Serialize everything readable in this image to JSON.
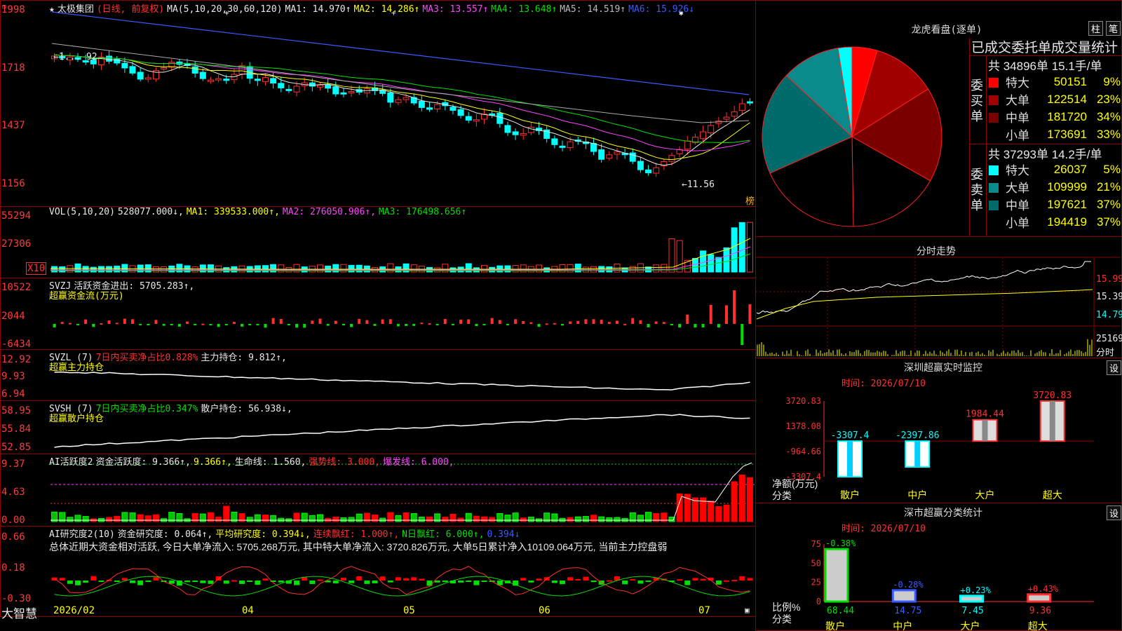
{
  "main": {
    "stock_name": "太极集团",
    "period": "(日线, 前复权)",
    "ma_label": "MA(5,10,20,30,60,120)",
    "ma": [
      {
        "name": "MA1:",
        "val": "14.970↑",
        "color": "#e8e8e8"
      },
      {
        "name": "MA2:",
        "val": "14.286↑",
        "color": "#ffff00"
      },
      {
        "name": "MA3:",
        "val": "13.557↑",
        "color": "#ff44ff"
      },
      {
        "name": "MA4:",
        "val": "13.648↑",
        "color": "#00e000"
      },
      {
        "name": "MA5:",
        "val": "14.519↑",
        "color": "#bbbbbb"
      },
      {
        "name": "MA6:",
        "val": "15.926↓",
        "color": "#3a5bff"
      }
    ],
    "y_ticks": [
      "1998",
      "1718",
      "1437",
      "1156"
    ],
    "high_mark": "←1... 92",
    "low_mark": "←11.56",
    "side_tag": "榜"
  },
  "vol": {
    "label": "VOL(5,10,20)",
    "v": "528077.000↓,",
    "ma1": "MA1: 339533.000↑,",
    "ma2": "MA2: 276050.906↑,",
    "ma3": "MA3: 176498.656↑",
    "y_ticks": [
      "55294",
      "27306"
    ],
    "x10": "X10"
  },
  "svzj": {
    "l1a": "SVZJ",
    "l1b": "活跃资金进出: 5705.283↑,",
    "l2": "超赢资金流(万元)",
    "y_ticks": [
      "10522",
      "2044",
      "-6434"
    ]
  },
  "svzl": {
    "l1a": "SVZL (7)",
    "l1b": "7日内买卖净占比0.828%",
    "l1c": "主力持仓: 9.812↑,",
    "l2": "超赢主力持仓",
    "y_ticks": [
      "12.92",
      "9.93",
      "6.94"
    ]
  },
  "svsh": {
    "l1a": "SVSH (7)",
    "l1b": "7日内买卖净占比0.347%",
    "l1c": "散户持仓: 56.938↓,",
    "l2": "超赢散户持仓",
    "y_ticks": [
      "58.95",
      "55.84",
      "52.85"
    ]
  },
  "ai1": {
    "a": "AI活跃度2",
    "b": "资金活跃度: 9.366↑,",
    "c": "9.366↑,",
    "d": "生命线: 1.560,",
    "e": "强势线: 3.000,",
    "f": "爆发线: 6.000,",
    "y_ticks": [
      "9.37",
      "4.63",
      "0.00"
    ]
  },
  "ai2": {
    "a": "AI研究度2(10)",
    "b": "资金研究度: 0.064↑,",
    "c": "平均研究度: 0.394↓,",
    "d": "连续飘红: 1.000↑,",
    "e": "N日飘红: 6.000↑,",
    "f": "0.394↓",
    "summary": "总体近期大资金相对活跃, 今日大单净流入: 5705.268万元, 其中特大单净流入: 3720.826万元, 大单5日累计净入10109.064万元, 当前主力控盘弱",
    "y_ticks": [
      "0.66",
      "0.18",
      "-0.30"
    ]
  },
  "xaxis": {
    "brand": "大智慧",
    "labels": [
      "2026/02",
      "04",
      "05",
      "06",
      "07"
    ]
  },
  "dragon": {
    "title": "龙虎看盘(逐单)",
    "tab1": "柱",
    "tab2": "笔",
    "stats_title": "已成交委托单成交量统计",
    "buy_side": "委买单",
    "sell_side": "委卖单",
    "buy_total": "共 34896单 15.1手/单",
    "sell_total": "共 37293单 14.2手/单",
    "buy": [
      {
        "name": "特大",
        "val": "50151",
        "pct": "9%",
        "color": "#ff0000"
      },
      {
        "name": "大单",
        "val": "122514",
        "pct": "23%",
        "color": "#a00000"
      },
      {
        "name": "中单",
        "val": "181720",
        "pct": "34%",
        "color": "#7a0000"
      },
      {
        "name": "小单",
        "val": "173691",
        "pct": "33%",
        "color": "#000000"
      }
    ],
    "sell": [
      {
        "name": "特大",
        "val": "26037",
        "pct": "5%",
        "color": "#00ffff"
      },
      {
        "name": "大单",
        "val": "109999",
        "pct": "21%",
        "color": "#0a8a8a"
      },
      {
        "name": "中单",
        "val": "197621",
        "pct": "37%",
        "color": "#006b6b"
      },
      {
        "name": "小单",
        "val": "194419",
        "pct": "37%",
        "color": "#000000"
      }
    ]
  },
  "intraday": {
    "title": "分时走势",
    "y_ticks": [
      "15.99",
      "15.39",
      "14.79"
    ],
    "vol_tick": "25169",
    "vol_label": "分时"
  },
  "monitor": {
    "title": "深圳超赢实时监控",
    "btn": "设",
    "time": "时间: 2026/07/10",
    "y_ticks": [
      "3720.83",
      "1378.08",
      "-964.66",
      "-3307.4"
    ],
    "unit": "净额(万元)",
    "cat_label": "分类",
    "cats": [
      "散户",
      "中户",
      "大户",
      "超大"
    ],
    "values_text": [
      "-3307.4",
      "-2397.86",
      "1984.44",
      "3720.83"
    ]
  },
  "classify": {
    "title": "深市超赢分类统计",
    "btn": "设",
    "time": "时间: 2026/07/10",
    "y_ticks": [
      "75",
      "50",
      "25",
      "0"
    ],
    "unit": "比例%",
    "cat_label": "分类",
    "cats": [
      "散户",
      "中户",
      "大户",
      "超大"
    ],
    "top_text": [
      "-0.38%",
      "-0.28%",
      "+0.23%",
      "+0.43%"
    ],
    "bottom_text": [
      "68.44",
      "14.75",
      "7.45",
      "9.36"
    ]
  },
  "chart_data": {
    "type": "bar",
    "title": "深圳超赢实时监控",
    "categories": [
      "散户",
      "中户",
      "大户",
      "超大"
    ],
    "series": [
      {
        "values": [
          -3307.4,
          -2397.86,
          1984.44,
          3720.83
        ]
      }
    ],
    "ylabel": "净额(万元)",
    "ylim": [
      -3307.4,
      3720.83
    ]
  }
}
